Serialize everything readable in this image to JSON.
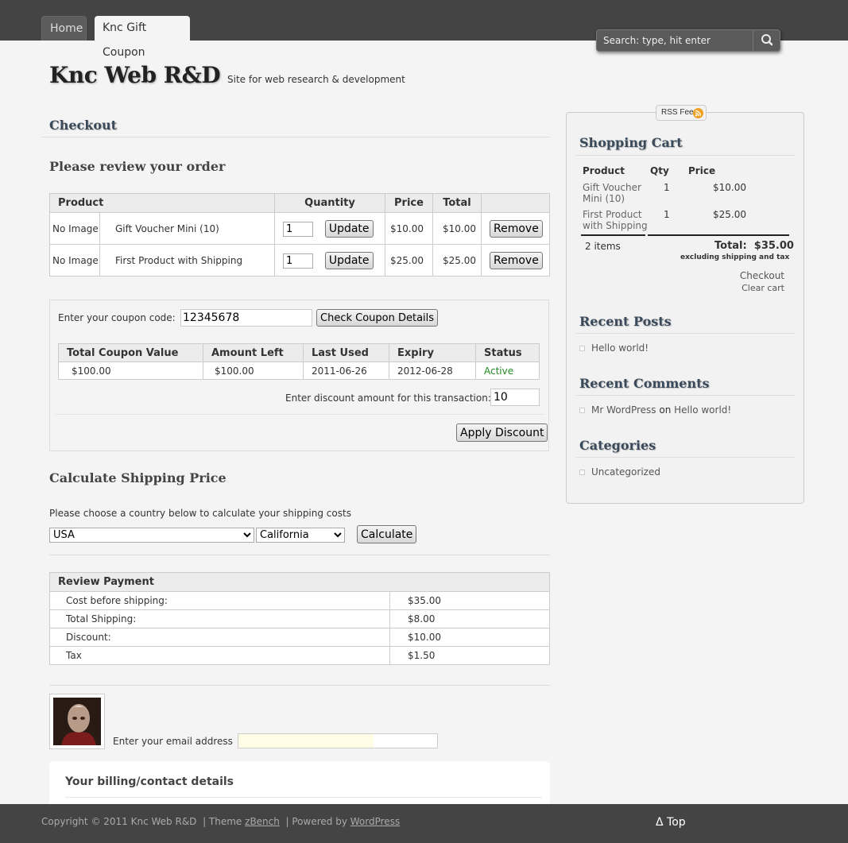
{
  "nav": {
    "tabs": [
      {
        "label": "Home"
      },
      {
        "label": "Knc Gift Coupon"
      }
    ],
    "search_placeholder": "Search: type, hit enter",
    "search_icon": "magnifier-icon"
  },
  "site": {
    "title": "Knc Web R&D",
    "description": "Site for web research & development"
  },
  "checkout": {
    "heading": "Checkout",
    "review_heading": "Please review your order",
    "cart_headers": [
      "Product",
      "Quantity",
      "Price",
      "Total"
    ],
    "cart_rows": [
      {
        "image": "No Image",
        "name": "Gift Voucher Mini (10)",
        "qty": "1",
        "update": "Update",
        "price": "$10.00",
        "total": "$10.00",
        "remove": "Remove"
      },
      {
        "image": "No Image",
        "name": "First Product with Shipping",
        "qty": "1",
        "update": "Update",
        "price": "$25.00",
        "total": "$25.00",
        "remove": "Remove"
      }
    ]
  },
  "coupon": {
    "label": "Enter your coupon code:",
    "code": "12345678",
    "check_button": "Check Coupon Details",
    "headers": [
      "Total Coupon Value",
      "Amount Left",
      "Last Used",
      "Expiry",
      "Status"
    ],
    "row": {
      "total": "$100.00",
      "left": "$100.00",
      "last_used": "2011-06-26",
      "expiry": "2012-06-28",
      "status": "Active"
    },
    "status_color": "#228B22",
    "discount_label": "Enter discount amount for this transaction:",
    "discount_value": "10",
    "apply_button": "Apply Discount"
  },
  "shipping": {
    "heading": "Calculate Shipping Price",
    "instruction": "Please choose a country below to calculate your shipping costs",
    "country": "USA",
    "region": "California",
    "calculate_button": "Calculate"
  },
  "payment": {
    "heading": "Review Payment",
    "rows": [
      {
        "label": "Cost before shipping:",
        "value": "$35.00"
      },
      {
        "label": "Total Shipping:",
        "value": "$8.00"
      },
      {
        "label": "Discount:",
        "value": "$10.00"
      },
      {
        "label": "Tax",
        "value": "$1.50"
      }
    ]
  },
  "email": {
    "label": "Enter your email address",
    "value": ""
  },
  "billing": {
    "heading": "Your billing/contact details"
  },
  "sidebar": {
    "rss": "RSS Feed",
    "cart": {
      "heading": "Shopping Cart",
      "headers": [
        "Product",
        "Qty",
        "Price"
      ],
      "items": [
        {
          "name_line1": "Gift Voucher",
          "name_line2": "Mini (10)",
          "qty": "1",
          "price": "$10.00"
        },
        {
          "name_line1": "First Product",
          "name_line2": "with Shipping",
          "qty": "1",
          "price": "$25.00"
        }
      ],
      "count": "2 items",
      "total_label": "Total:",
      "total_value": "$35.00",
      "excluding": "excluding shipping and tax",
      "checkout_link": "Checkout",
      "clear_link": "Clear cart"
    },
    "recent_posts": {
      "heading": "Recent Posts",
      "items": [
        "Hello world!"
      ]
    },
    "recent_comments": {
      "heading": "Recent Comments",
      "author": "Mr WordPress",
      "on": "on",
      "post": "Hello world!"
    },
    "categories": {
      "heading": "Categories",
      "items": [
        "Uncategorized"
      ]
    }
  },
  "footer": {
    "copyright": "Copyright © 2011 Knc Web R&D",
    "theme_prefix": "| Theme",
    "theme_name": "zBench",
    "powered_prefix": "| Powered by",
    "powered_name": "WordPress",
    "top_link": "Δ Top"
  }
}
